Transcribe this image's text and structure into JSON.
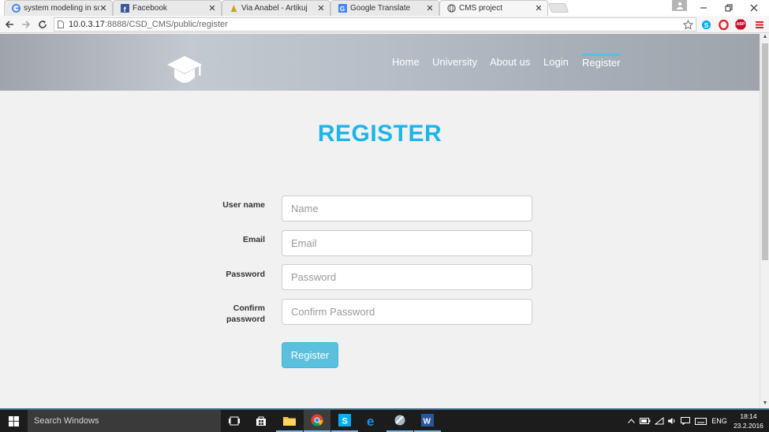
{
  "browser": {
    "tabs": [
      {
        "title": "system modeling in softw",
        "favicon": "google-icon",
        "active": false
      },
      {
        "title": "Facebook",
        "favicon": "facebook-icon",
        "active": false
      },
      {
        "title": "Via Anabel - Artikuj",
        "favicon": "via-anabel-icon",
        "active": false
      },
      {
        "title": "Google Translate",
        "favicon": "google-translate-icon",
        "active": false
      },
      {
        "title": "CMS project",
        "favicon": "globe-icon",
        "active": true
      }
    ],
    "url_host": "10.0.3.17",
    "url_rest": ":8888/CSD_CMS/public/register",
    "extensions": [
      "skype-icon",
      "opera-icon",
      "adblock-plus-icon"
    ],
    "abp_label": "ABP"
  },
  "site": {
    "nav": [
      "Home",
      "University",
      "About us",
      "Login",
      "Register"
    ],
    "active_nav": "Register",
    "page_title": "REGISTER"
  },
  "form": {
    "fields": [
      {
        "label": "User name",
        "placeholder": "Name"
      },
      {
        "label": "Email",
        "placeholder": "Email"
      },
      {
        "label": "Password",
        "placeholder": "Password"
      },
      {
        "label": "Confirm password",
        "placeholder": "Confirm Password"
      }
    ],
    "submit_label": "Register"
  },
  "taskbar": {
    "search_placeholder": "Search Windows",
    "language": "ENG",
    "time": "18:14",
    "date": "23.2.2016",
    "apps": [
      "task-view-icon",
      "store-icon",
      "file-explorer-icon",
      "chrome-icon",
      "skype-icon",
      "edge-icon",
      "app-icon",
      "word-icon"
    ]
  },
  "colors": {
    "accent": "#1eb5e8",
    "button": "#5bc0de",
    "nav_active_bar": "#4fc3e8"
  }
}
